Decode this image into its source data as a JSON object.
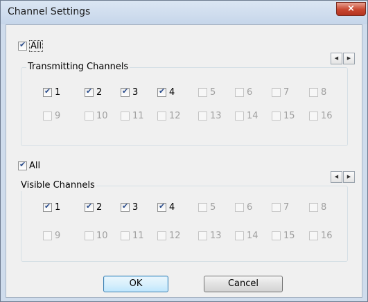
{
  "window": {
    "title": "Channel Settings",
    "close_glyph": "×"
  },
  "transmitting": {
    "all_label": "All",
    "all_checked": true,
    "group_title": "Transmitting Channels",
    "spin_left": "◀",
    "spin_right": "▶",
    "channels": [
      {
        "label": "1",
        "checked": true,
        "enabled": true
      },
      {
        "label": "2",
        "checked": true,
        "enabled": true
      },
      {
        "label": "3",
        "checked": true,
        "enabled": true
      },
      {
        "label": "4",
        "checked": true,
        "enabled": true
      },
      {
        "label": "5",
        "checked": false,
        "enabled": false
      },
      {
        "label": "6",
        "checked": false,
        "enabled": false
      },
      {
        "label": "7",
        "checked": false,
        "enabled": false
      },
      {
        "label": "8",
        "checked": false,
        "enabled": false
      },
      {
        "label": "9",
        "checked": false,
        "enabled": false
      },
      {
        "label": "10",
        "checked": false,
        "enabled": false
      },
      {
        "label": "11",
        "checked": false,
        "enabled": false
      },
      {
        "label": "12",
        "checked": false,
        "enabled": false
      },
      {
        "label": "13",
        "checked": false,
        "enabled": false
      },
      {
        "label": "14",
        "checked": false,
        "enabled": false
      },
      {
        "label": "15",
        "checked": false,
        "enabled": false
      },
      {
        "label": "16",
        "checked": false,
        "enabled": false
      }
    ]
  },
  "visible": {
    "all_label": "All",
    "all_checked": true,
    "group_title": "Visible Channels",
    "spin_left": "◀",
    "spin_right": "▶",
    "channels": [
      {
        "label": "1",
        "checked": true,
        "enabled": true
      },
      {
        "label": "2",
        "checked": true,
        "enabled": true
      },
      {
        "label": "3",
        "checked": true,
        "enabled": true
      },
      {
        "label": "4",
        "checked": true,
        "enabled": true
      },
      {
        "label": "5",
        "checked": false,
        "enabled": false
      },
      {
        "label": "6",
        "checked": false,
        "enabled": false
      },
      {
        "label": "7",
        "checked": false,
        "enabled": false
      },
      {
        "label": "8",
        "checked": false,
        "enabled": false
      },
      {
        "label": "9",
        "checked": false,
        "enabled": false
      },
      {
        "label": "10",
        "checked": false,
        "enabled": false
      },
      {
        "label": "11",
        "checked": false,
        "enabled": false
      },
      {
        "label": "12",
        "checked": false,
        "enabled": false
      },
      {
        "label": "13",
        "checked": false,
        "enabled": false
      },
      {
        "label": "14",
        "checked": false,
        "enabled": false
      },
      {
        "label": "15",
        "checked": false,
        "enabled": false
      },
      {
        "label": "16",
        "checked": false,
        "enabled": false
      }
    ]
  },
  "buttons": {
    "ok_label": "OK",
    "cancel_label": "Cancel"
  },
  "colors": {
    "frame": "#cfdcec",
    "close_button": "#c8462f",
    "check_mark": "#2a4c8c",
    "disabled_text": "#a0a0a0"
  }
}
